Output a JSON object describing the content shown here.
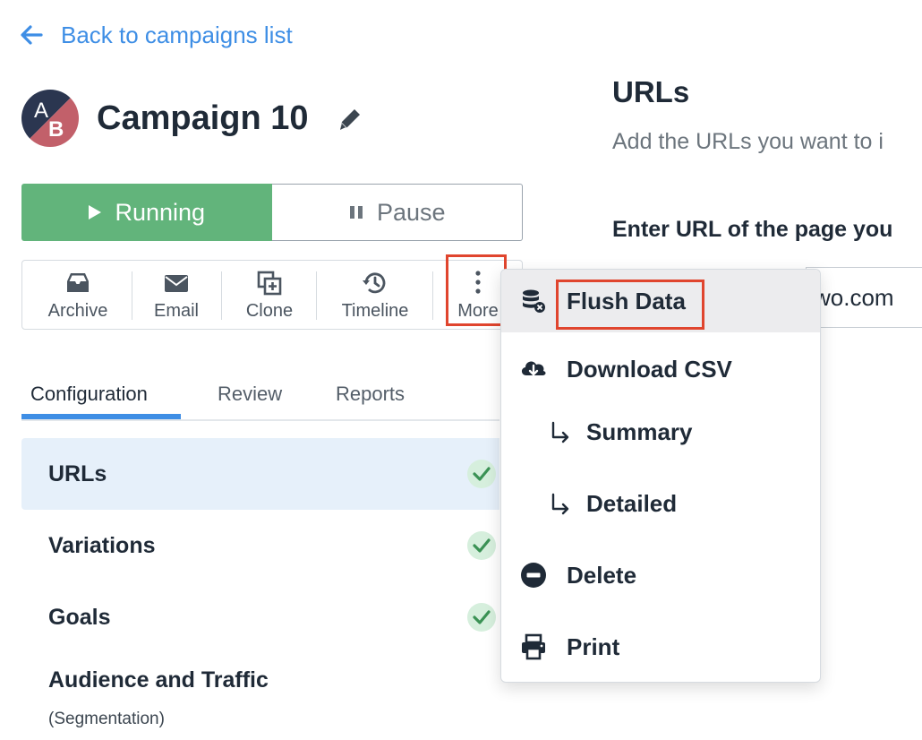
{
  "nav": {
    "back_label": "Back to campaigns list"
  },
  "campaign": {
    "avatar_letter_a": "A",
    "avatar_letter_b": "B",
    "title": "Campaign 10"
  },
  "status": {
    "running_label": "Running",
    "pause_label": "Pause"
  },
  "toolbar": {
    "archive": "Archive",
    "email": "Email",
    "clone": "Clone",
    "timeline": "Timeline",
    "more": "More"
  },
  "tabs": {
    "configuration": "Configuration",
    "review": "Review",
    "reports": "Reports"
  },
  "config": {
    "urls": "URLs",
    "variations": "Variations",
    "goals": "Goals",
    "audience": "Audience and Traffic",
    "audience_sub": "(Segmentation)"
  },
  "panel": {
    "title": "URLs",
    "description": "Add the URLs you want to i",
    "url_label": "Enter URL of the page you",
    "url_value": "wo.com"
  },
  "menu": {
    "flush": "Flush Data",
    "download_csv": "Download CSV",
    "summary": "Summary",
    "detailed": "Detailed",
    "delete": "Delete",
    "print": "Print"
  },
  "colors": {
    "accent": "#3e8ee5",
    "running": "#62b47b",
    "highlight": "#e0452e",
    "avatar_a": "#2b3650",
    "avatar_b": "#c2606a"
  }
}
